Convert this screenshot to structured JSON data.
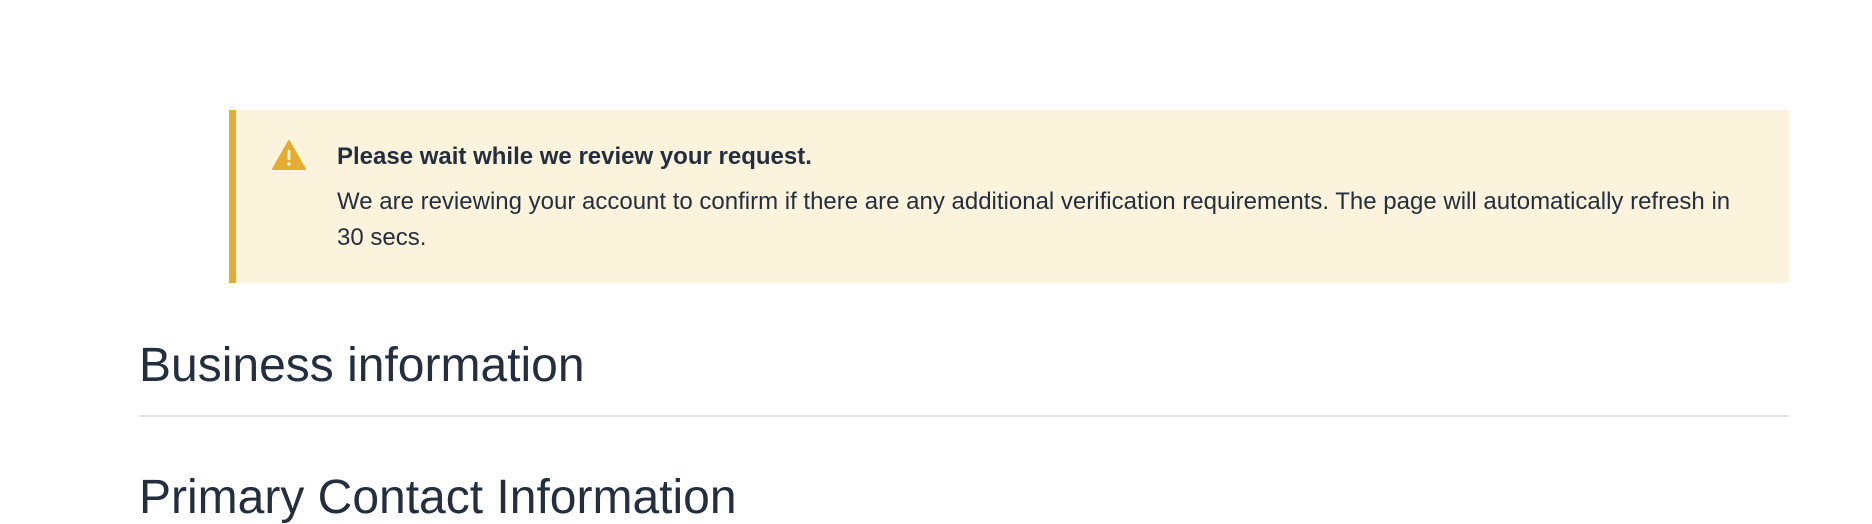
{
  "alert": {
    "icon": "warning-triangle-icon",
    "title": "Please wait while we review your request.",
    "message": "We are reviewing your account to confirm if there are any additional verification requirements. The page will automatically refresh in 30 secs.",
    "accent_color": "#e4ad32",
    "background_color": "#fcf3dc"
  },
  "sections": {
    "business_title": "Business information",
    "contact_title": "Primary Contact Information"
  },
  "theme": {
    "text_color": "#232f3e",
    "divider_color": "#e1e4e8"
  }
}
